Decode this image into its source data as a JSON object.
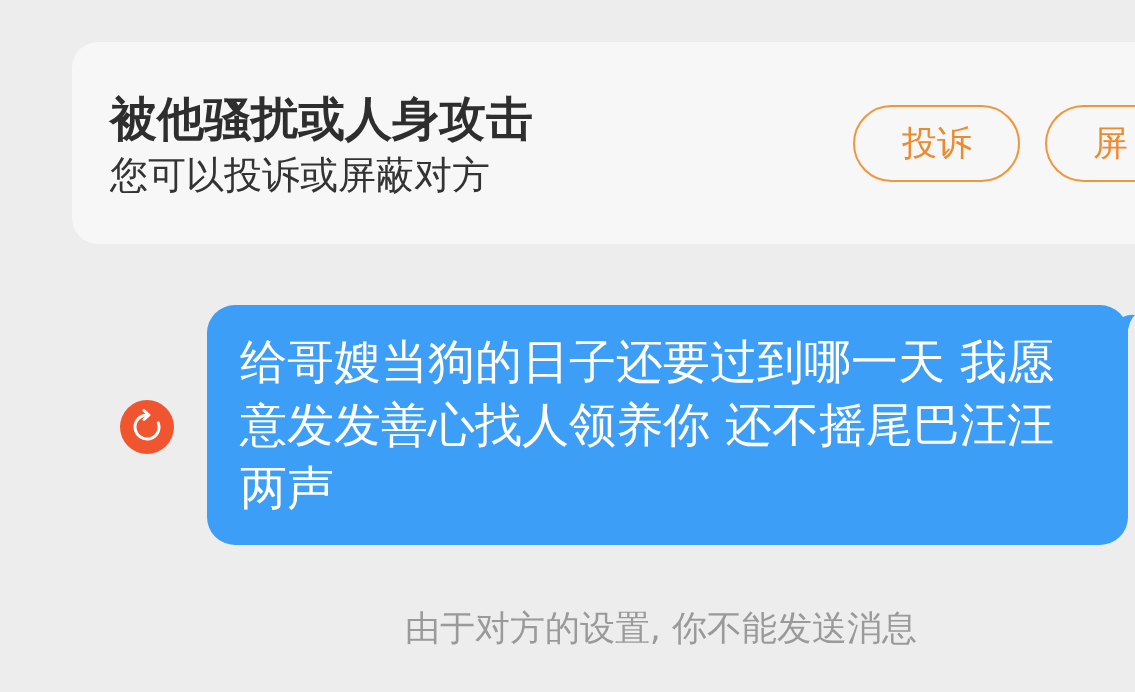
{
  "notice_card": {
    "title": "被他骚扰或人身攻击",
    "subtitle": "您可以投诉或屏蔽对方",
    "buttons": [
      {
        "label": "投诉"
      },
      {
        "label": "屏"
      }
    ]
  },
  "messages": [
    {
      "text": "给哥嫂当狗的日子还要过到哪一天 我愿意发发善心找人领养你 还不摇尾巴汪汪两声",
      "send_failed": true
    }
  ],
  "system_notice": "由于对方的设置, 你不能发送消息"
}
